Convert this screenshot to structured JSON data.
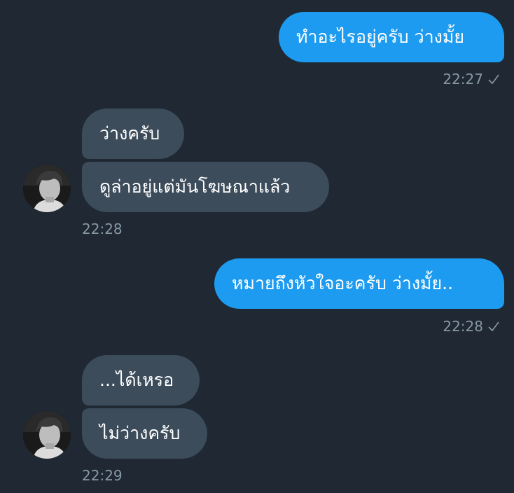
{
  "messages": [
    {
      "id": "m1",
      "direction": "outgoing",
      "text": "ทำอะไรอยู่ครับ ว่างมั้ย",
      "time": "22:27",
      "status": "sent"
    },
    {
      "id": "m2",
      "direction": "incoming",
      "text": "ว่างครับ"
    },
    {
      "id": "m3",
      "direction": "incoming",
      "text": "ดูล่าอยู่แต่มันโฆษณาแล้ว",
      "time": "22:28"
    },
    {
      "id": "m4",
      "direction": "outgoing",
      "text": "หมายถึงหัวใจอะครับ ว่างมั้ย..",
      "time": "22:28",
      "status": "sent"
    },
    {
      "id": "m5",
      "direction": "incoming",
      "text": "...ได้เหรอ"
    },
    {
      "id": "m6",
      "direction": "incoming",
      "text": "ไม่ว่างครับ",
      "time": "22:29"
    }
  ],
  "icons": {
    "read_status": "checkmark-icon",
    "avatar": "user-avatar"
  },
  "colors": {
    "background": "#1f2833",
    "outgoing_bubble": "#1d9bf0",
    "incoming_bubble": "#3c4c5b",
    "meta_text": "#8899a6"
  }
}
